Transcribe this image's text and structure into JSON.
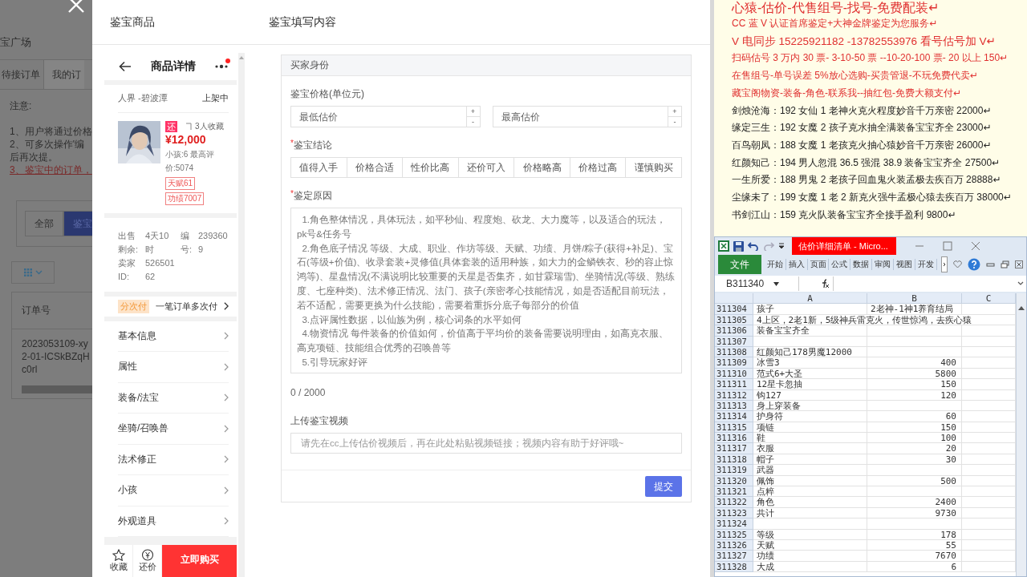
{
  "background_page": {
    "title": "宝广场",
    "tabs": [
      {
        "label": "待接订单",
        "selected": false
      },
      {
        "label": "我的订",
        "selected": true
      }
    ],
    "notice_title": "注意:",
    "notes": [
      {
        "text": "1、用户将通过价格",
        "kind": "plain"
      },
      {
        "text": "2、可多次操作'编",
        "kind": "plain"
      },
      {
        "text": "后再次提。",
        "kind": "plain"
      },
      {
        "text": "3、鉴宝中的订单，",
        "kind": "alert"
      }
    ],
    "filters": [
      {
        "label": "全部",
        "selected": false
      },
      {
        "label": "鉴宝",
        "selected": true
      }
    ],
    "table": {
      "columns": [
        "订单号"
      ],
      "rows": [
        [
          "2023053109-xy2-01-ICSkBZqHc0rl"
        ]
      ]
    }
  },
  "product_panel": {
    "title": "鉴宝商品",
    "header_title": "商品详情",
    "has_notification": true,
    "region": "人界 -碧波潭",
    "status": "上架中",
    "badge": "还",
    "favorites": "3人收藏",
    "price": "¥12,000",
    "summary": "小孩:6 最高评价:5074",
    "tags": [
      "天赋61",
      "功绩7007"
    ],
    "info": [
      {
        "label": "出售剩余:",
        "value": "4天10时"
      },
      {
        "label": "编号:",
        "value": "2393609"
      },
      {
        "label": "卖家ID:",
        "value": "52650162"
      }
    ],
    "installment": {
      "tag": "分次付",
      "text": "一笔订单多次付"
    },
    "menu": [
      "基本信息",
      "属性",
      "装备/法宝",
      "坐骑/召唤兽",
      "法术修正",
      "小孩",
      "外观道具"
    ],
    "actions": [
      {
        "kind": "star",
        "label": "收藏"
      },
      {
        "kind": "yen",
        "label": "还价"
      },
      {
        "kind": "primary",
        "label": "立即购买"
      }
    ]
  },
  "appraisal_form": {
    "title": "鉴宝填写内容",
    "section": "买家身份",
    "price": {
      "label": "鉴宝价格(单位元)",
      "fields": [
        {
          "placeholder": "最低估价",
          "increment": "+",
          "decrement": "-"
        },
        {
          "placeholder": "最高估价",
          "increment": "+",
          "decrement": "-"
        }
      ]
    },
    "conclusion": {
      "label": "鉴宝结论",
      "required_mark": "*",
      "options": [
        {
          "label": "值得入手",
          "selected": false
        },
        {
          "label": "价格合适",
          "selected": false
        },
        {
          "label": "性价比高",
          "selected": false
        },
        {
          "label": "还价可入",
          "selected": false
        },
        {
          "label": "价格略高",
          "selected": false
        },
        {
          "label": "价格过高",
          "selected": false
        },
        {
          "label": "谨慎购买",
          "selected": false
        }
      ]
    },
    "reason": {
      "label": "鉴定原因",
      "required_mark": "*",
      "placeholder": "  1.角色整体情况，具体玩法，如平秒仙、程度炮、砍龙、大力魔等，以及适合的玩法，pk号&任务号\n  2.角色底子情况 等级、大成、职业、作坊等级、天赋、功绩、月饼/粽子(获得+补足)、宝石(等级+价值)、收录套装+灵修值(具体套装的适用种族，如大力的金鳞铁衣、秒的容止惊鸿等)、星盘情况(不满说明比较重要的天星是否集齐，如甘霖瑞雪)、坐骑情况(等级、熟练度、七座种类)、法术修正情况、法门、孩子(亲密孝心技能情况，如是否适配目前玩法，若不适配，需要更换为什么技能)，需要着重拆分底子每部分的价值\n  3.点评属性数据，以仙族为例，核心词条的水平如何\n  4.物资情况 每件装备的价值如何，价值高于平均价的装备需要说明理由，如高克衣服、高克项链、技能组合优秀的召唤兽等\n  5.引导玩家好评",
      "counter": "0 / 2000"
    },
    "video": {
      "label": "上传鉴宝视频",
      "placeholder": "请先在cc上传估价视频后，再在此处粘贴视频链接；视频内容有助于好评哦~"
    },
    "submit": "提交"
  },
  "ad_document": {
    "lines": [
      {
        "text": "心猿-估价-代售组号-找号-免费配装↵",
        "kind": "headline"
      },
      {
        "text": "CC 蓝 V 认证首席鉴定+大神金牌鉴定为您服务↵",
        "kind": "promo"
      },
      {
        "text": "V 电同步 15225921182 -13782553976 看号估号加 V↵",
        "kind": "promo_large"
      },
      {
        "text": "扫码估号 3 万内 30 票- 3-10-50 票  --10-20-100 票- 20 以上 150↵",
        "kind": "promo"
      },
      {
        "text": "在售组号-单号误差 5%放心选购-买贵管退-不玩免费代卖↵",
        "kind": "promo"
      },
      {
        "text": "藏宝阁物资-装备-角色-联系我--抽红包-免费大额支付↵",
        "kind": "promo"
      },
      {
        "text": "剑烛沧海：192 女仙 1 老神火克火程度妙音千万亲密 22000↵",
        "kind": "listing"
      },
      {
        "text": "缘定三生：192 女魔 2 孩子克水抽全满装备宝宝齐全 23000↵",
        "kind": "listing"
      },
      {
        "text": "百鸟朝凤：188 女魔 1 老孩克火抽心猿妙音千万亲密 26000↵",
        "kind": "listing"
      },
      {
        "text": "红颜知己：194 男人忽混 36.5 强混 38.9 装备宝宝齐全 27500↵",
        "kind": "listing"
      },
      {
        "text": "一生所爱：188 男鬼 2 老孩子回血鬼火装孟极去疾百万 28888↵",
        "kind": "listing"
      },
      {
        "text": "尘缘未了：199 女魔 1 老 2 新克火强牛孟极心猿去疾百万 38000↵",
        "kind": "listing"
      },
      {
        "text": "书剑江山：159 克火队装备宝宝齐全接手盈利 9800↵",
        "kind": "listing"
      }
    ]
  },
  "spreadsheet_window": {
    "title": "估价详细清单 - Micro...",
    "ribbon_tabs": [
      {
        "label": "文件",
        "selected": true
      },
      {
        "label": "开始",
        "selected": false
      },
      {
        "label": "插入",
        "selected": false
      },
      {
        "label": "页面",
        "selected": false
      },
      {
        "label": "公式",
        "selected": false
      },
      {
        "label": "数据",
        "selected": false
      },
      {
        "label": "审阅",
        "selected": false
      },
      {
        "label": "视图",
        "selected": false
      },
      {
        "label": "开发",
        "selected": false
      }
    ],
    "name_box": "B311340",
    "columns": [
      "A",
      "B",
      "C"
    ],
    "rows": [
      {
        "number": "311304",
        "kind": "label",
        "cells": [
          "孩子",
          "2老神-1神1养育结局"
        ]
      },
      {
        "number": "311305",
        "kind": "label",
        "cells": [
          "4上区，2老1新，5级神兵雷克火，传世惊鸿，去疾心猿"
        ]
      },
      {
        "number": "311306",
        "kind": "label",
        "cells": [
          "装备宝宝齐全",
          ""
        ]
      },
      {
        "number": "311307",
        "kind": "label",
        "cells": [
          "",
          ""
        ]
      },
      {
        "number": "311308",
        "kind": "label",
        "cells": [
          "红颜知己178男魔12000",
          ""
        ]
      },
      {
        "number": "311309",
        "kind": "value",
        "cells": [
          "冰雪3",
          "400"
        ]
      },
      {
        "number": "311310",
        "kind": "value",
        "cells": [
          "范式6+大圣",
          "5800"
        ]
      },
      {
        "number": "311311",
        "kind": "value",
        "cells": [
          "12星卡忽抽",
          "150"
        ]
      },
      {
        "number": "311312",
        "kind": "value",
        "cells": [
          "钩127",
          "120"
        ]
      },
      {
        "number": "311313",
        "kind": "value",
        "cells": [
          "身上穿装备",
          ""
        ]
      },
      {
        "number": "311314",
        "kind": "value",
        "cells": [
          "护身符",
          "60"
        ]
      },
      {
        "number": "311315",
        "kind": "value",
        "cells": [
          "项链",
          "150"
        ]
      },
      {
        "number": "311316",
        "kind": "value",
        "cells": [
          "鞋",
          "100"
        ]
      },
      {
        "number": "311317",
        "kind": "value",
        "cells": [
          "衣服",
          "20"
        ]
      },
      {
        "number": "311318",
        "kind": "value",
        "cells": [
          "帽子",
          "30"
        ]
      },
      {
        "number": "311319",
        "kind": "value",
        "cells": [
          "武器",
          ""
        ]
      },
      {
        "number": "311320",
        "kind": "value",
        "cells": [
          "佩饰",
          "500"
        ]
      },
      {
        "number": "311321",
        "kind": "value",
        "cells": [
          "点粹",
          ""
        ]
      },
      {
        "number": "311322",
        "kind": "value",
        "cells": [
          "角色",
          "2400"
        ]
      },
      {
        "number": "311323",
        "kind": "value",
        "cells": [
          "共计",
          "9730"
        ]
      },
      {
        "number": "311324",
        "kind": "value",
        "cells": [
          "",
          ""
        ]
      },
      {
        "number": "311325",
        "kind": "value",
        "cells": [
          "等级",
          "178"
        ]
      },
      {
        "number": "311326",
        "kind": "value",
        "cells": [
          "天赋",
          "55"
        ]
      },
      {
        "number": "311327",
        "kind": "value",
        "cells": [
          "功绩",
          "7670"
        ]
      },
      {
        "number": "311328",
        "kind": "value",
        "cells": [
          "大成",
          "6"
        ]
      }
    ]
  }
}
